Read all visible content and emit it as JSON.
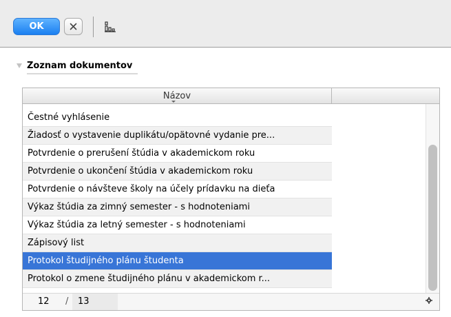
{
  "toolbar": {
    "ok_label": "OK",
    "cancel_icon": "close-icon",
    "extra_icon": "hierarchy-icon"
  },
  "section": {
    "title": "Zoznam dokumentov"
  },
  "grid": {
    "column_header": "Názov",
    "rows": [
      "Čestné vyhlásenie",
      "Žiadosť o vystavenie duplikátu/opätovné vydanie pre...",
      "Potvrdenie o prerušení štúdia v akademickom roku",
      "Potvrdenie o ukončení štúdia v akademickom roku",
      "Potvrdenie o návšteve školy na účely prídavku na dieťa",
      "Výkaz štúdia za zimný semester - s hodnoteniami",
      "Výkaz štúdia za letný semester - s hodnoteniami",
      "Zápisový list",
      "Protokol študijného plánu študenta",
      "Protokol o zmene študijného plánu v akademickom r..."
    ],
    "selected_index": 8,
    "scroll_fraction": 0.22
  },
  "footer": {
    "current": "12",
    "separator": "/",
    "total": "13",
    "settings_icon": "gear-icon"
  },
  "colors": {
    "accent": "#1a7ff0",
    "selection": "#3875d7"
  }
}
